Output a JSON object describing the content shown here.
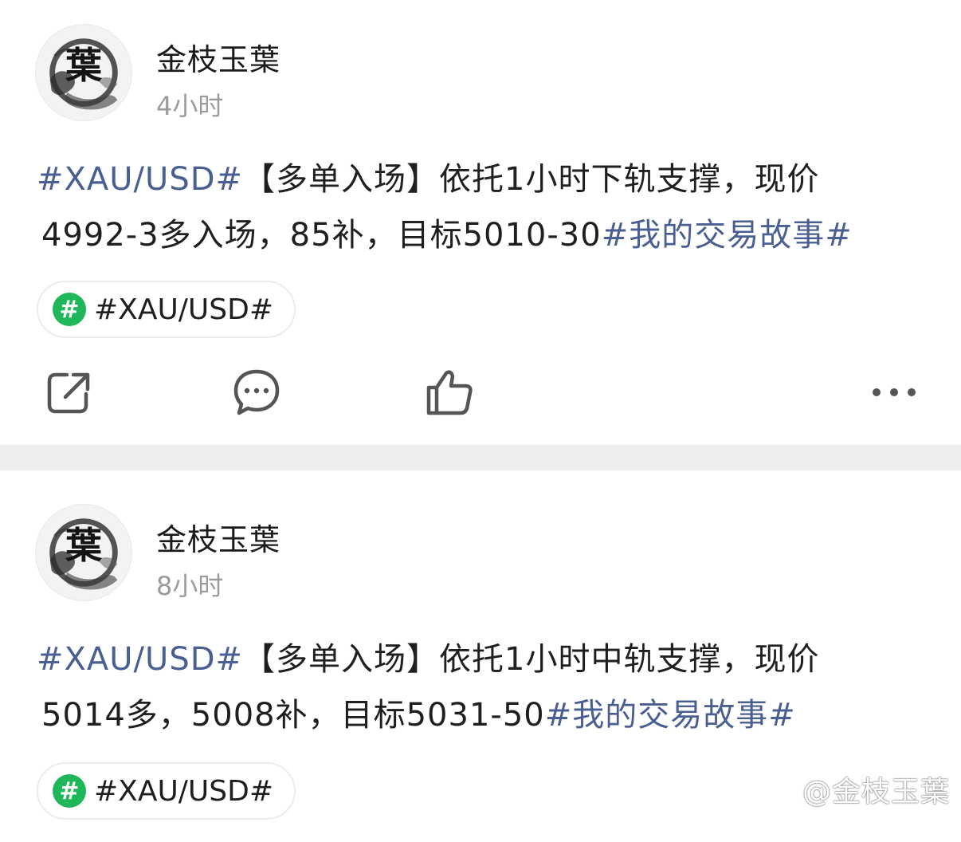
{
  "posts": [
    {
      "author": "金枝玉葉",
      "avatar_char": "葉",
      "time": "4小时",
      "content": {
        "tag_start": "#XAU/USD#",
        "line1_text": "【多单入场】依托1小时下轨支撑，现价",
        "line2_text": "4992-3多入场，85补，目标5010-30",
        "tag_end": "#我的交易故事#"
      },
      "topic": {
        "icon": "#",
        "label": "#XAU/USD#"
      }
    },
    {
      "author": "金枝玉葉",
      "avatar_char": "葉",
      "time": "8小时",
      "content": {
        "tag_start": "#XAU/USD#",
        "line1_text": "【多单入场】依托1小时中轨支撑，现价",
        "line2_text": "5014多，5008补，目标5031-50",
        "tag_end": "#我的交易故事#"
      },
      "topic": {
        "icon": "#",
        "label": "#XAU/USD#"
      }
    }
  ],
  "actions": [
    "share-icon",
    "comment-icon",
    "like-icon",
    "more-icon"
  ],
  "watermark": "@金枝玉葉",
  "colors": {
    "tag": "#4a5f91",
    "topic_icon": "#20b65a",
    "separator": "#eeeeee"
  }
}
